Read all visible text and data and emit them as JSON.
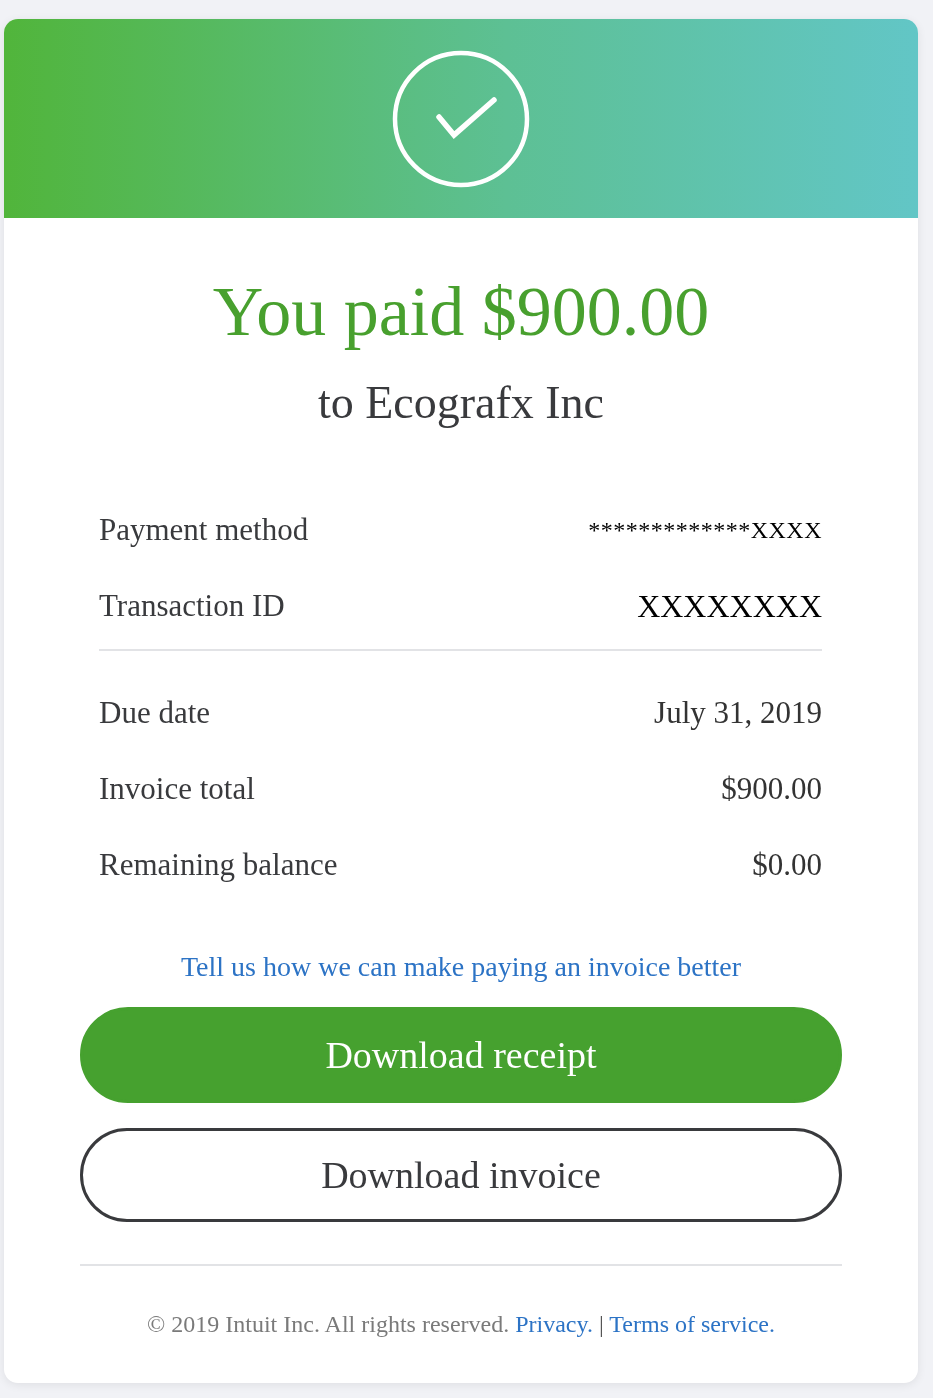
{
  "summary": {
    "amount": "You paid $900.00",
    "payee": "to Ecografx Inc"
  },
  "detail_groups": [
    {
      "rows": [
        {
          "label": "Payment method",
          "value": "*************XXXX",
          "kind": "card"
        },
        {
          "label": "Transaction ID",
          "value": "XXXXXXXX",
          "kind": "id"
        }
      ]
    },
    {
      "rows": [
        {
          "label": "Due date",
          "value": "July 31, 2019",
          "kind": "text"
        },
        {
          "label": "Invoice total",
          "value": "$900.00",
          "kind": "text"
        },
        {
          "label": "Remaining balance",
          "value": "$0.00",
          "kind": "text"
        }
      ]
    }
  ],
  "feedback_link": "Tell us how we can make paying an invoice better",
  "buttons": [
    {
      "label": "Download receipt",
      "kind": "primary"
    },
    {
      "label": "Download invoice",
      "kind": "outline"
    }
  ],
  "footer": {
    "copyright": "© 2019 Intuit Inc. All rights reserved.",
    "links": [
      "Privacy.",
      "Terms of service."
    ],
    "separator": "|"
  }
}
